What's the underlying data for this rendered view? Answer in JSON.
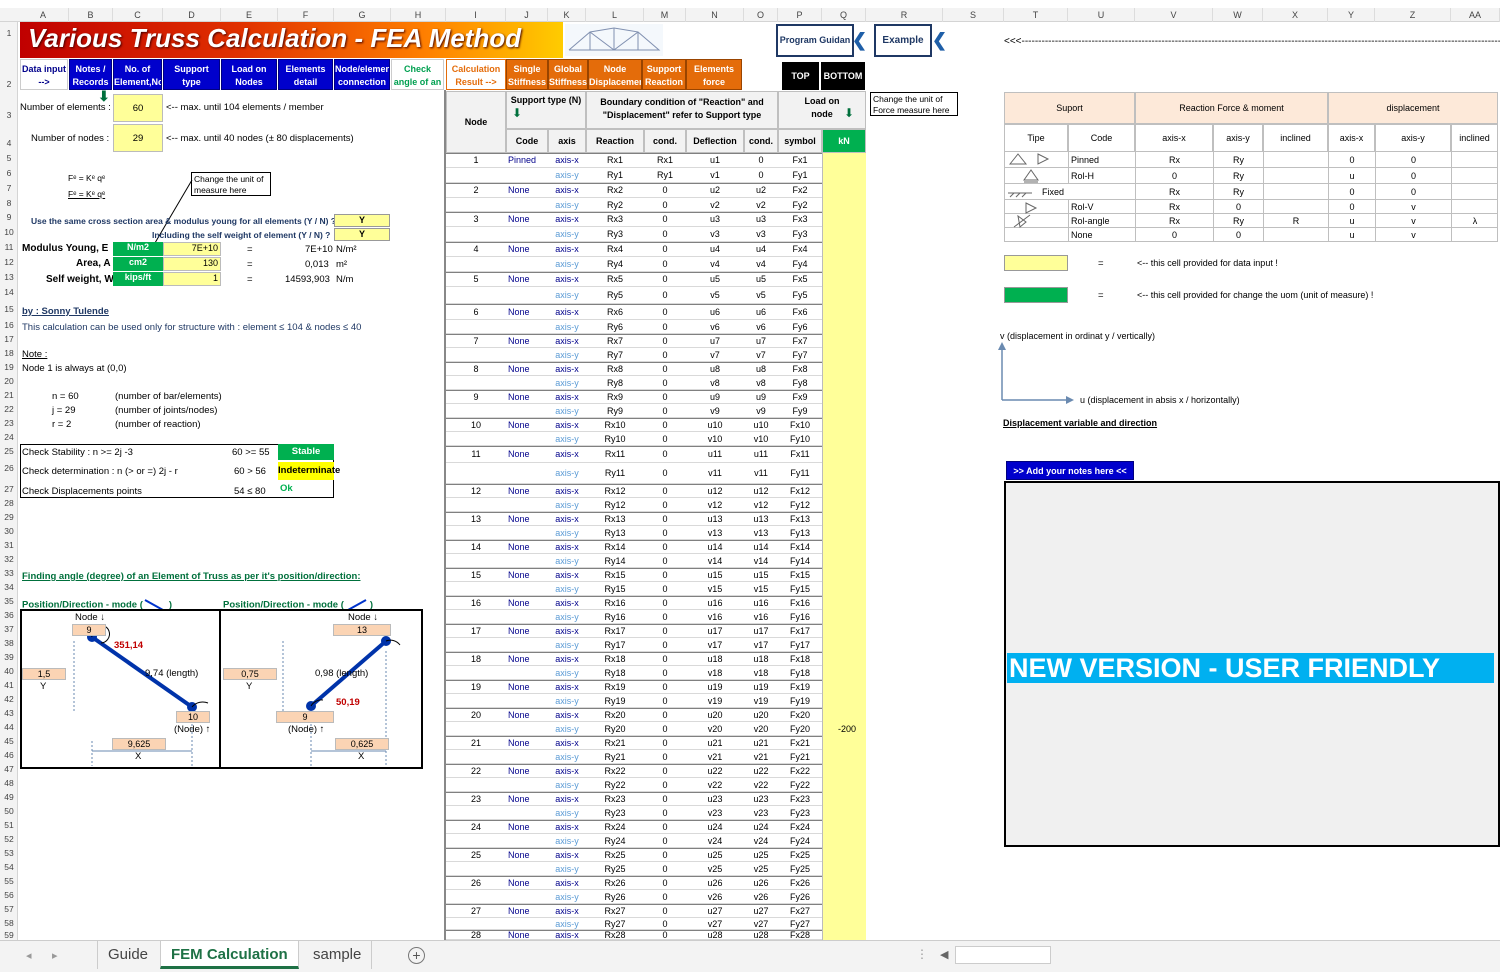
{
  "title": "Various Truss Calculation - FEA Method",
  "buttons": {
    "program_guide": "Program Guidan",
    "example": "Example",
    "top": "TOP",
    "bottom": "BOTTOM",
    "arrows": "<<<------------------------------------------------------------------------------------------------------------------------------------------------------------------------------------"
  },
  "columns": [
    "A",
    "B",
    "C",
    "D",
    "E",
    "F",
    "G",
    "H",
    "I",
    "J",
    "K",
    "L",
    "M",
    "N",
    "O",
    "P",
    "Q",
    "R",
    "S",
    "T",
    "U",
    "V",
    "W",
    "X",
    "Y",
    "Z",
    "AA"
  ],
  "rows": [
    "1",
    "2",
    "3",
    "4",
    "5",
    "6",
    "7",
    "8",
    "9",
    "10",
    "11",
    "12",
    "13",
    "14",
    "15",
    "16",
    "17",
    "18",
    "19",
    "20",
    "21",
    "22",
    "23",
    "24",
    "25",
    "26",
    "27",
    "28",
    "29",
    "30",
    "31",
    "32",
    "33",
    "34",
    "35",
    "36",
    "37",
    "38",
    "39",
    "40",
    "41",
    "42",
    "43",
    "44",
    "45",
    "46",
    "47",
    "48",
    "49",
    "50",
    "51",
    "52",
    "53",
    "54",
    "55",
    "56",
    "57",
    "58",
    "59"
  ],
  "nav": [
    {
      "label": "Data input -->"
    },
    {
      "label": "Notes / Records"
    },
    {
      "label": "No. of Element,Node"
    },
    {
      "label": "Support type"
    },
    {
      "label": "Load on Nodes"
    },
    {
      "label": "Elements detail"
    },
    {
      "label": "Node/element connection"
    },
    {
      "label": "Check angle of an element"
    }
  ],
  "nav2": [
    "Calculation Result -->",
    "Single Stiffness",
    "Global Stiffness",
    "Node Displacement",
    "Support Reaction",
    "Elements force"
  ],
  "left": {
    "num_elements_label": "Number of elements :",
    "num_elements": "60",
    "num_elements_note": "<-- max. until 104 elements / member",
    "num_nodes_label": "Number of nodes :",
    "num_nodes": "29",
    "num_nodes_note": "<-- max. until 40 nodes (± 80 displacements)",
    "eq1": "Fᵉ = Kᵉ qᵉ",
    "eq2": "Fᵉ = Kᵉ qᵉ",
    "unit_note": "Change the unit of measure here",
    "same_section_label": "Use the same cross section area & modulus young for all elements (Y / N) ?",
    "same_section": "Y",
    "self_weight_label": "Including the self weight of element (Y / N) ?",
    "self_weight": "Y",
    "modulus_label": "Modulus Young, E",
    "modulus_unit": "N/m2",
    "modulus_val": "7E+10",
    "modulus_res": "7E+10",
    "modulus_res_unit": "N/m²",
    "area_label": "Area, A",
    "area_unit": "cm2",
    "area_val": "130",
    "area_res": "0,013",
    "area_res_unit": "m²",
    "sw_label": "Self weight, W",
    "sw_unit": "kips/ft",
    "sw_val": "1",
    "sw_res": "14593,903",
    "sw_res_unit": "N/m",
    "eq": "=",
    "author": "by : Sonny Tulende",
    "usage": "This calculation can be used only for structure with : element ≤ 104 & nodes ≤ 40",
    "note_h": "Note :",
    "note1": "Node 1 is always at (0,0)",
    "n": "n = 60",
    "n_d": "(number of bar/elements)",
    "j": "j = 29",
    "j_d": "(number of joints/nodes)",
    "r": "r = 2",
    "r_d": "(number of reaction)",
    "chk1": "Check Stability : n >= 2j -3",
    "chk1_v": "60 >= 55",
    "chk1_r": "Stable",
    "chk2": "Check determination : n (> or =) 2j - r",
    "chk2_v": "60 > 56",
    "chk2_r": "Indeterminate",
    "chk3": "Check Displacements points",
    "chk3_v": "54 ≤ 80",
    "chk3_r": "Ok",
    "angle_title": "Finding angle (degree) of an Element of Truss as per it's position/direction:",
    "mode1": "Position/Direction - mode (",
    "mode2": "Position/Direction - mode (",
    "mode_end": ")",
    "d1": {
      "node_lbl": "Node ↓",
      "node_top": "9",
      "angle": "351,14",
      "len": "9,74  (length)",
      "y": "1,5",
      "ylbl": "Y",
      "node_bot": "10",
      "node_bot_lbl": "(Node) ↑",
      "x": "9,625",
      "xlbl": "X"
    },
    "d2": {
      "node_lbl": "Node ↓",
      "node_top": "13",
      "angle": "50,19",
      "len": "0,98  (length)",
      "y": "0,75",
      "ylbl": "Y",
      "node_bot": "9",
      "node_bot_lbl": "(Node) ↑",
      "x": "0,625",
      "xlbl": "X"
    }
  },
  "mid": {
    "node_h": "Node",
    "support_h": "Support type (N)",
    "code_h": "Code",
    "axis_h": "axis",
    "boundary_h": "Boundary condition of \"Reaction\" and \"Displacement\" refer to Support type",
    "reaction_h": "Reaction",
    "cond_h": "cond.",
    "defl_h": "Deflection",
    "cond2_h": "cond.",
    "load_h": "Load on node",
    "symbol_h": "symbol",
    "kn": "kN",
    "unit_note": "Change the unit of Force measure here",
    "rows": [
      {
        "n": "1",
        "code": "Pinned",
        "ax": "axis-x",
        "r": "Rx1",
        "c": "Rx1",
        "d": "u1",
        "c2": "0",
        "s": "Fx1",
        "v": ""
      },
      {
        "n": "",
        "code": "",
        "ax": "axis-y",
        "r": "Ry1",
        "c": "Ry1",
        "d": "v1",
        "c2": "0",
        "s": "Fy1",
        "v": ""
      },
      {
        "n": "2",
        "code": "None",
        "ax": "axis-x",
        "r": "Rx2",
        "c": "0",
        "d": "u2",
        "c2": "u2",
        "s": "Fx2",
        "v": ""
      },
      {
        "n": "",
        "code": "",
        "ax": "axis-y",
        "r": "Ry2",
        "c": "0",
        "d": "v2",
        "c2": "v2",
        "s": "Fy2",
        "v": ""
      },
      {
        "n": "3",
        "code": "None",
        "ax": "axis-x",
        "r": "Rx3",
        "c": "0",
        "d": "u3",
        "c2": "u3",
        "s": "Fx3",
        "v": ""
      },
      {
        "n": "",
        "code": "",
        "ax": "axis-y",
        "r": "Ry3",
        "c": "0",
        "d": "v3",
        "c2": "v3",
        "s": "Fy3",
        "v": ""
      },
      {
        "n": "4",
        "code": "None",
        "ax": "axis-x",
        "r": "Rx4",
        "c": "0",
        "d": "u4",
        "c2": "u4",
        "s": "Fx4",
        "v": ""
      },
      {
        "n": "",
        "code": "",
        "ax": "axis-y",
        "r": "Ry4",
        "c": "0",
        "d": "v4",
        "c2": "v4",
        "s": "Fy4",
        "v": ""
      },
      {
        "n": "5",
        "code": "None",
        "ax": "axis-x",
        "r": "Rx5",
        "c": "0",
        "d": "u5",
        "c2": "u5",
        "s": "Fx5",
        "v": ""
      },
      {
        "n": "",
        "code": "",
        "ax": "axis-y",
        "r": "Ry5",
        "c": "0",
        "d": "v5",
        "c2": "v5",
        "s": "Fy5",
        "v": ""
      },
      {
        "n": "6",
        "code": "None",
        "ax": "axis-x",
        "r": "Rx6",
        "c": "0",
        "d": "u6",
        "c2": "u6",
        "s": "Fx6",
        "v": ""
      },
      {
        "n": "",
        "code": "",
        "ax": "axis-y",
        "r": "Ry6",
        "c": "0",
        "d": "v6",
        "c2": "v6",
        "s": "Fy6",
        "v": ""
      },
      {
        "n": "7",
        "code": "None",
        "ax": "axis-x",
        "r": "Rx7",
        "c": "0",
        "d": "u7",
        "c2": "u7",
        "s": "Fx7",
        "v": ""
      },
      {
        "n": "",
        "code": "",
        "ax": "axis-y",
        "r": "Ry7",
        "c": "0",
        "d": "v7",
        "c2": "v7",
        "s": "Fy7",
        "v": ""
      },
      {
        "n": "8",
        "code": "None",
        "ax": "axis-x",
        "r": "Rx8",
        "c": "0",
        "d": "u8",
        "c2": "u8",
        "s": "Fx8",
        "v": ""
      },
      {
        "n": "",
        "code": "",
        "ax": "axis-y",
        "r": "Ry8",
        "c": "0",
        "d": "v8",
        "c2": "v8",
        "s": "Fy8",
        "v": ""
      },
      {
        "n": "9",
        "code": "None",
        "ax": "axis-x",
        "r": "Rx9",
        "c": "0",
        "d": "u9",
        "c2": "u9",
        "s": "Fx9",
        "v": ""
      },
      {
        "n": "",
        "code": "",
        "ax": "axis-y",
        "r": "Ry9",
        "c": "0",
        "d": "v9",
        "c2": "v9",
        "s": "Fy9",
        "v": ""
      },
      {
        "n": "10",
        "code": "None",
        "ax": "axis-x",
        "r": "Rx10",
        "c": "0",
        "d": "u10",
        "c2": "u10",
        "s": "Fx10",
        "v": ""
      },
      {
        "n": "",
        "code": "",
        "ax": "axis-y",
        "r": "Ry10",
        "c": "0",
        "d": "v10",
        "c2": "v10",
        "s": "Fy10",
        "v": ""
      },
      {
        "n": "11",
        "code": "None",
        "ax": "axis-x",
        "r": "Rx11",
        "c": "0",
        "d": "u11",
        "c2": "u11",
        "s": "Fx11",
        "v": ""
      },
      {
        "n": "",
        "code": "",
        "ax": "axis-y",
        "r": "Ry11",
        "c": "0",
        "d": "v11",
        "c2": "v11",
        "s": "Fy11",
        "v": ""
      },
      {
        "n": "12",
        "code": "None",
        "ax": "axis-x",
        "r": "Rx12",
        "c": "0",
        "d": "u12",
        "c2": "u12",
        "s": "Fx12",
        "v": ""
      },
      {
        "n": "",
        "code": "",
        "ax": "axis-y",
        "r": "Ry12",
        "c": "0",
        "d": "v12",
        "c2": "v12",
        "s": "Fy12",
        "v": ""
      },
      {
        "n": "13",
        "code": "None",
        "ax": "axis-x",
        "r": "Rx13",
        "c": "0",
        "d": "u13",
        "c2": "u13",
        "s": "Fx13",
        "v": ""
      },
      {
        "n": "",
        "code": "",
        "ax": "axis-y",
        "r": "Ry13",
        "c": "0",
        "d": "v13",
        "c2": "v13",
        "s": "Fy13",
        "v": ""
      },
      {
        "n": "14",
        "code": "None",
        "ax": "axis-x",
        "r": "Rx14",
        "c": "0",
        "d": "u14",
        "c2": "u14",
        "s": "Fx14",
        "v": ""
      },
      {
        "n": "",
        "code": "",
        "ax": "axis-y",
        "r": "Ry14",
        "c": "0",
        "d": "v14",
        "c2": "v14",
        "s": "Fy14",
        "v": ""
      },
      {
        "n": "15",
        "code": "None",
        "ax": "axis-x",
        "r": "Rx15",
        "c": "0",
        "d": "u15",
        "c2": "u15",
        "s": "Fx15",
        "v": ""
      },
      {
        "n": "",
        "code": "",
        "ax": "axis-y",
        "r": "Ry15",
        "c": "0",
        "d": "v15",
        "c2": "v15",
        "s": "Fy15",
        "v": ""
      },
      {
        "n": "16",
        "code": "None",
        "ax": "axis-x",
        "r": "Rx16",
        "c": "0",
        "d": "u16",
        "c2": "u16",
        "s": "Fx16",
        "v": ""
      },
      {
        "n": "",
        "code": "",
        "ax": "axis-y",
        "r": "Ry16",
        "c": "0",
        "d": "v16",
        "c2": "v16",
        "s": "Fy16",
        "v": ""
      },
      {
        "n": "17",
        "code": "None",
        "ax": "axis-x",
        "r": "Rx17",
        "c": "0",
        "d": "u17",
        "c2": "u17",
        "s": "Fx17",
        "v": ""
      },
      {
        "n": "",
        "code": "",
        "ax": "axis-y",
        "r": "Ry17",
        "c": "0",
        "d": "v17",
        "c2": "v17",
        "s": "Fy17",
        "v": ""
      },
      {
        "n": "18",
        "code": "None",
        "ax": "axis-x",
        "r": "Rx18",
        "c": "0",
        "d": "u18",
        "c2": "u18",
        "s": "Fx18",
        "v": ""
      },
      {
        "n": "",
        "code": "",
        "ax": "axis-y",
        "r": "Ry18",
        "c": "0",
        "d": "v18",
        "c2": "v18",
        "s": "Fy18",
        "v": ""
      },
      {
        "n": "19",
        "code": "None",
        "ax": "axis-x",
        "r": "Rx19",
        "c": "0",
        "d": "u19",
        "c2": "u19",
        "s": "Fx19",
        "v": ""
      },
      {
        "n": "",
        "code": "",
        "ax": "axis-y",
        "r": "Ry19",
        "c": "0",
        "d": "v19",
        "c2": "v19",
        "s": "Fy19",
        "v": ""
      },
      {
        "n": "20",
        "code": "None",
        "ax": "axis-x",
        "r": "Rx20",
        "c": "0",
        "d": "u20",
        "c2": "u20",
        "s": "Fx20",
        "v": ""
      },
      {
        "n": "",
        "code": "",
        "ax": "axis-y",
        "r": "Ry20",
        "c": "0",
        "d": "v20",
        "c2": "v20",
        "s": "Fy20",
        "v": "-200"
      },
      {
        "n": "21",
        "code": "None",
        "ax": "axis-x",
        "r": "Rx21",
        "c": "0",
        "d": "u21",
        "c2": "u21",
        "s": "Fx21",
        "v": ""
      },
      {
        "n": "",
        "code": "",
        "ax": "axis-y",
        "r": "Ry21",
        "c": "0",
        "d": "v21",
        "c2": "v21",
        "s": "Fy21",
        "v": ""
      },
      {
        "n": "22",
        "code": "None",
        "ax": "axis-x",
        "r": "Rx22",
        "c": "0",
        "d": "u22",
        "c2": "u22",
        "s": "Fx22",
        "v": ""
      },
      {
        "n": "",
        "code": "",
        "ax": "axis-y",
        "r": "Ry22",
        "c": "0",
        "d": "v22",
        "c2": "v22",
        "s": "Fy22",
        "v": ""
      },
      {
        "n": "23",
        "code": "None",
        "ax": "axis-x",
        "r": "Rx23",
        "c": "0",
        "d": "u23",
        "c2": "u23",
        "s": "Fx23",
        "v": ""
      },
      {
        "n": "",
        "code": "",
        "ax": "axis-y",
        "r": "Ry23",
        "c": "0",
        "d": "v23",
        "c2": "v23",
        "s": "Fy23",
        "v": ""
      },
      {
        "n": "24",
        "code": "None",
        "ax": "axis-x",
        "r": "Rx24",
        "c": "0",
        "d": "u24",
        "c2": "u24",
        "s": "Fx24",
        "v": ""
      },
      {
        "n": "",
        "code": "",
        "ax": "axis-y",
        "r": "Ry24",
        "c": "0",
        "d": "v24",
        "c2": "v24",
        "s": "Fy24",
        "v": ""
      },
      {
        "n": "25",
        "code": "None",
        "ax": "axis-x",
        "r": "Rx25",
        "c": "0",
        "d": "u25",
        "c2": "u25",
        "s": "Fx25",
        "v": ""
      },
      {
        "n": "",
        "code": "",
        "ax": "axis-y",
        "r": "Ry25",
        "c": "0",
        "d": "v25",
        "c2": "v25",
        "s": "Fy25",
        "v": ""
      },
      {
        "n": "26",
        "code": "None",
        "ax": "axis-x",
        "r": "Rx26",
        "c": "0",
        "d": "u26",
        "c2": "u26",
        "s": "Fx26",
        "v": ""
      },
      {
        "n": "",
        "code": "",
        "ax": "axis-y",
        "r": "Ry26",
        "c": "0",
        "d": "v26",
        "c2": "v26",
        "s": "Fy26",
        "v": ""
      },
      {
        "n": "27",
        "code": "None",
        "ax": "axis-x",
        "r": "Rx27",
        "c": "0",
        "d": "u27",
        "c2": "u27",
        "s": "Fx27",
        "v": ""
      },
      {
        "n": "",
        "code": "",
        "ax": "axis-y",
        "r": "Ry27",
        "c": "0",
        "d": "v27",
        "c2": "v27",
        "s": "Fy27",
        "v": ""
      },
      {
        "n": "28",
        "code": "None",
        "ax": "axis-x",
        "r": "Rx28",
        "c": "0",
        "d": "u28",
        "c2": "u28",
        "s": "Fx28",
        "v": ""
      }
    ]
  },
  "right": {
    "suport_h": "Suport",
    "reaction_h": "Reaction Force & moment",
    "disp_h": "displacement",
    "tipe": "Tipe",
    "code": "Code",
    "ax": "axis-x",
    "ay": "axis-y",
    "inc": "inclined",
    "dx": "axis-x",
    "dy": "axis-y",
    "dinc": "inclined",
    "rows": [
      {
        "code": "Pinned",
        "rx": "Rx",
        "ry": "Ry",
        "ri": "",
        "dx": "0",
        "dy": "0",
        "di": ""
      },
      {
        "code": "Rol-H",
        "rx": "0",
        "ry": "Ry",
        "ri": "",
        "dx": "u",
        "dy": "0",
        "di": ""
      },
      {
        "code": "Fixed",
        "rx": "Rx",
        "ry": "Ry",
        "ri": "",
        "dx": "0",
        "dy": "0",
        "di": ""
      },
      {
        "code": "Rol-V",
        "rx": "Rx",
        "ry": "0",
        "ri": "",
        "dx": "0",
        "dy": "v",
        "di": ""
      },
      {
        "code": "Rol-angle",
        "rx": "Rx",
        "ry": "Ry",
        "ri": "R",
        "dx": "u",
        "dy": "v",
        "di": "λ"
      },
      {
        "code": "None",
        "rx": "0",
        "ry": "0",
        "ri": "",
        "dx": "u",
        "dy": "v",
        "di": ""
      }
    ],
    "eq": "=",
    "yel_note": "<-- this cell provided for data input !",
    "grn_note": "<-- this cell provided for change the uom (unit of measure) !",
    "v_lbl": "v (displacement in ordinat y / vertically)",
    "u_lbl": "u (displacement in absis x / horizontally)",
    "dir_title": "Displacement variable and direction",
    "notes_btn": ">> Add your notes here <<",
    "banner": "NEW VERSION - USER FRIENDLY"
  },
  "tabs": {
    "guide": "Guide",
    "fem": "FEM Calculation",
    "sample": "sample",
    "add": "+"
  }
}
